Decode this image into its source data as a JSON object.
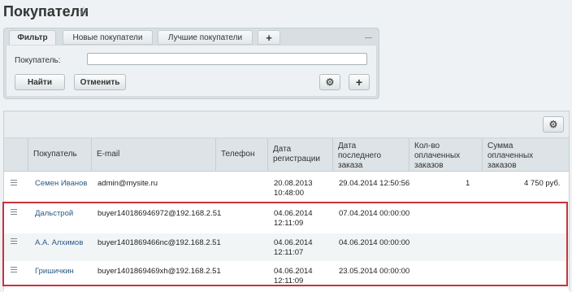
{
  "page": {
    "title": "Покупатели",
    "star_icon": "star-icon"
  },
  "filter": {
    "tabs": [
      {
        "label": "Фильтр",
        "active": true
      },
      {
        "label": "Новые покупатели",
        "active": false
      },
      {
        "label": "Лучшие покупатели",
        "active": false
      },
      {
        "label": "+",
        "active": false
      }
    ],
    "buyer_label": "Покупатель:",
    "buyer_value": "",
    "find_label": "Найти",
    "cancel_label": "Отменить",
    "gear_icon": "gear-icon",
    "add_icon": "plus-icon"
  },
  "grid": {
    "headers": [
      "Покупатель",
      "E-mail",
      "Телефон",
      "Дата регистрации",
      "Дата последнего заказа",
      "Кол-во оплаченных заказов",
      "Сумма оплаченных заказов"
    ],
    "header_lines": {
      "reg": [
        "Дата",
        "регистрации"
      ],
      "last": [
        "Дата",
        "последнего",
        "заказа"
      ],
      "count": [
        "Кол-во",
        "оплаченных",
        "заказов"
      ],
      "sum": [
        "Сумма",
        "оплаченных",
        "заказов"
      ]
    },
    "rows": [
      {
        "name": "Семен Иванов",
        "email": "admin@mysite.ru",
        "phone": "",
        "reg_date": "20.08.2013",
        "reg_time": "10:48:00",
        "last_order": "29.04.2014 12:50:56",
        "paid_count": "1",
        "paid_sum": "4 750 руб."
      },
      {
        "name": "Дальстрой",
        "email": "buyer140186946972@192.168.2.51",
        "phone": "",
        "reg_date": "04.06.2014",
        "reg_time": "12:11:09",
        "last_order": "07.04.2014 00:00:00",
        "paid_count": "",
        "paid_sum": ""
      },
      {
        "name": "А.А. Алхимов",
        "email": "buyer1401869466nc@192.168.2.51",
        "phone": "",
        "reg_date": "04.06.2014",
        "reg_time": "12:11:07",
        "last_order": "04.06.2014 00:00:00",
        "paid_count": "",
        "paid_sum": ""
      },
      {
        "name": "Гришичкин",
        "email": "buyer1401869469xh@192.168.2.51",
        "phone": "",
        "reg_date": "04.06.2014",
        "reg_time": "12:11:09",
        "last_order": "23.05.2014 00:00:00",
        "paid_count": "",
        "paid_sum": ""
      }
    ]
  },
  "colors": {
    "highlight": "#c9323c",
    "link": "#2b5988"
  }
}
